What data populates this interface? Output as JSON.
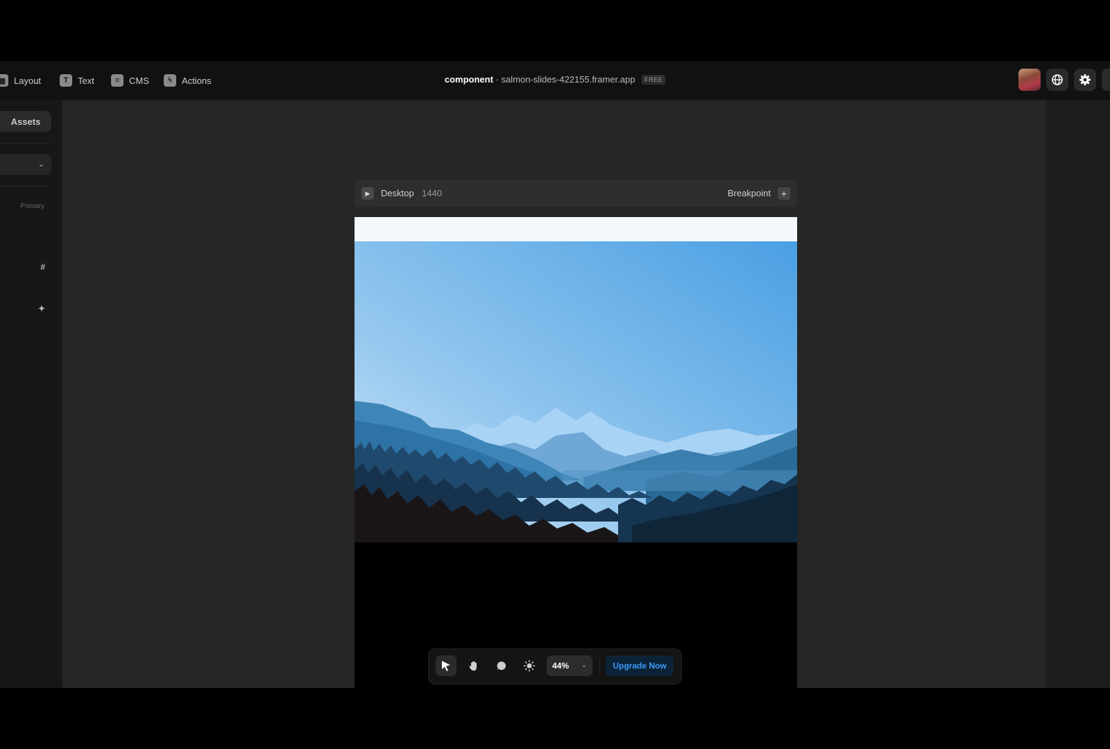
{
  "toolbar": {
    "items": [
      {
        "label": "Layout",
        "icon": "layout-icon"
      },
      {
        "label": "Text",
        "icon": "text-icon"
      },
      {
        "label": "CMS",
        "icon": "cms-icon"
      },
      {
        "label": "Actions",
        "icon": "actions-icon"
      }
    ]
  },
  "project": {
    "name": "component",
    "separator": "·",
    "domain": "salmon-slides-422155.framer.app",
    "plan_badge": "FREE"
  },
  "left_panel": {
    "assets_label": "Assets",
    "section_label": "Primary"
  },
  "frame": {
    "breakpoint_name": "Desktop",
    "width_value": "1440",
    "breakpoint_button": "Breakpoint"
  },
  "bottom_toolbar": {
    "zoom": "44%",
    "upgrade_label": "Upgrade Now"
  },
  "colors": {
    "accent": "#3a9bff",
    "background": "#262626",
    "topbar": "#111111"
  }
}
